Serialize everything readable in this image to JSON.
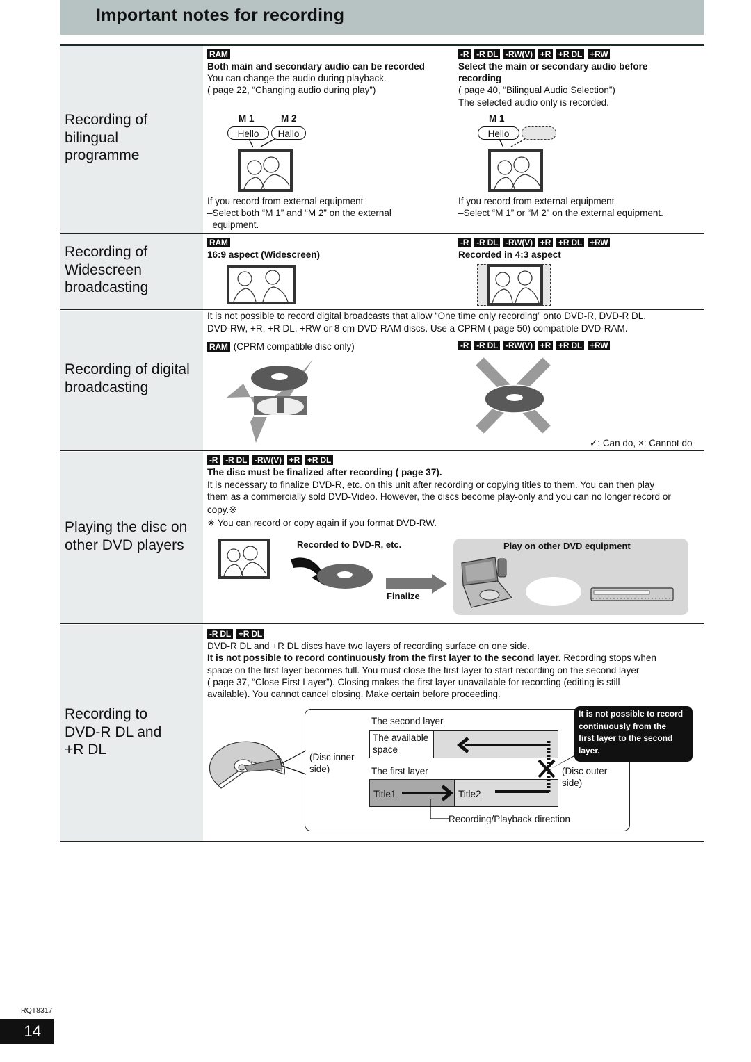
{
  "header": {
    "title": "Important notes for recording"
  },
  "sections": {
    "bilingual": {
      "label_lines": [
        "Recording of",
        "bilingual",
        "programme"
      ],
      "left": {
        "badges": [
          "RAM"
        ],
        "heading": "Both main and secondary audio can be recorded",
        "lines": [
          "You can change the audio during playback.",
          "(    page 22, “Changing audio during play”)"
        ],
        "channels": [
          "M 1",
          "M 2"
        ],
        "bubbles": [
          "Hello",
          "Hallo"
        ],
        "note_lines": [
          "If you record from external equipment",
          "–Select both “M 1” and “M 2” on the external",
          "  equipment."
        ]
      },
      "right": {
        "badges": [
          "-R",
          "-R DL",
          "-RW(V)",
          "+R",
          "+R DL",
          "+RW"
        ],
        "heading_lines": [
          "Select the main or secondary audio before",
          "recording"
        ],
        "lines": [
          "(    page 40, “Bilingual Audio Selection”)",
          "The selected audio only is recorded."
        ],
        "channels": [
          "M 1"
        ],
        "bubbles": [
          "Hello"
        ],
        "note_lines": [
          "If you record from external equipment",
          "–Select “M 1” or “M 2” on the external equipment."
        ]
      }
    },
    "widescreen": {
      "label_lines": [
        "Recording of",
        "Widescreen",
        "broadcasting"
      ],
      "left": {
        "badges": [
          "RAM"
        ],
        "heading": "16:9 aspect (Widescreen)"
      },
      "right": {
        "badges": [
          "-R",
          "-R DL",
          "-RW(V)",
          "+R",
          "+R DL",
          "+RW"
        ],
        "heading": "Recorded in 4:3 aspect"
      }
    },
    "digital": {
      "label_lines": [
        "Recording of digital",
        "broadcasting"
      ],
      "intro_lines": [
        "It is not possible to record digital broadcasts that allow “One time only recording” onto DVD-R, DVD-R DL,",
        "DVD-RW, +R, +R DL, +RW or 8 cm DVD-RAM discs. Use a CPRM (    page 50) compatible DVD-RAM."
      ],
      "left": {
        "badges": [
          "RAM"
        ],
        "caption": "(CPRM compatible disc only)"
      },
      "right": {
        "badges": [
          "-R",
          "-R DL",
          "-RW(V)",
          "+R",
          "+R DL",
          "+RW"
        ]
      },
      "legend": "✓: Can do, ×: Cannot do"
    },
    "other_players": {
      "label_lines": [
        "Playing the disc on",
        "other DVD players"
      ],
      "badges": [
        "-R",
        "-R DL",
        "-RW(V)",
        "+R",
        "+R DL"
      ],
      "heading": "The disc must be finalized after recording (    page 37).",
      "lines": [
        "It is necessary to finalize DVD-R, etc. on this unit after recording or copying titles to them. You can then play",
        "them as a commercially sold DVD-Video. However, the discs become play-only and you can no longer record or",
        "copy.※",
        "※ You can record or copy again if you format DVD-RW."
      ],
      "recorded_label": "Recorded to DVD-R, etc.",
      "finalize_label": "Finalize",
      "play_label": "Play on other DVD equipment"
    },
    "dual_layer": {
      "label_lines": [
        "Recording to",
        "DVD-R DL and",
        "+R DL"
      ],
      "badges": [
        "-R DL",
        "+R DL"
      ],
      "line1": "DVD-R DL and +R DL discs have two layers of recording surface on one side.",
      "bold_part": "It is not possible to record continuously from the first layer to the second layer.",
      "after_bold": " Recording stops when",
      "lines": [
        "space on the first layer becomes full. You must close the first layer to start recording on the second layer",
        "(    page 37, “Close First Layer”). Closing makes the first layer unavailable for recording (editing is still",
        "available). You cannot cancel closing. Make certain before proceeding."
      ],
      "diagram": {
        "second_layer": "The second layer",
        "available_space_lines": [
          "The available",
          "space"
        ],
        "first_layer": "The first layer",
        "title1": "Title1",
        "title2": "Title2",
        "inner_side_lines": [
          "(Disc inner",
          "side)"
        ],
        "outer_side_lines": [
          "(Disc outer",
          "side)"
        ],
        "direction": "Recording/Playback direction",
        "callout_lines": [
          "It is not possible to record",
          "continuously from the",
          "first layer to the second",
          "layer."
        ]
      }
    }
  },
  "footer": {
    "code": "RQT8317",
    "page_number": "14"
  }
}
